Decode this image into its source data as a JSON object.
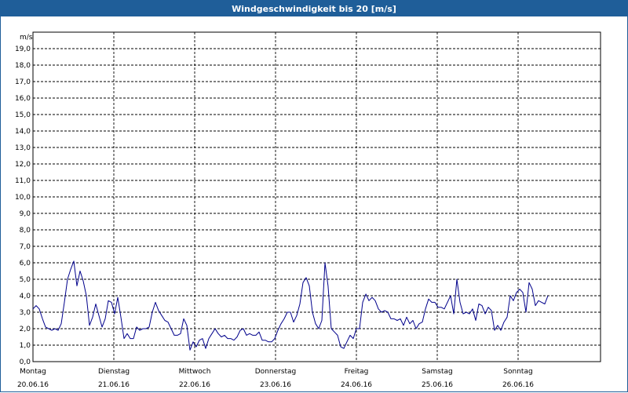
{
  "window": {
    "title": "Windgeschwindigkeit bis 20 [m/s]"
  },
  "colors": {
    "titlebar": "#1f5e99",
    "line": "#00008b"
  },
  "chart_data": {
    "type": "line",
    "title": "Windgeschwindigkeit bis 20 [m/s]",
    "ylabel": "m/s",
    "xlabel": "",
    "ylim": [
      0,
      20
    ],
    "yticks": [
      "0,0",
      "1,0",
      "2,0",
      "3,0",
      "4,0",
      "5,0",
      "6,0",
      "7,0",
      "8,0",
      "9,0",
      "10,0",
      "11,0",
      "12,0",
      "13,0",
      "14,0",
      "15,0",
      "16,0",
      "17,0",
      "18,0",
      "19,0"
    ],
    "xlim": [
      0,
      7
    ],
    "x_unit": "days from Monday 20.06.16 00:00",
    "day_labels": [
      {
        "day": "Montag",
        "date": "20.06.16"
      },
      {
        "day": "Dienstag",
        "date": "21.06.16"
      },
      {
        "day": "Mittwoch",
        "date": "22.06.16"
      },
      {
        "day": "Donnerstag",
        "date": "23.06.16"
      },
      {
        "day": "Freitag",
        "date": "24.06.16"
      },
      {
        "day": "Samstag",
        "date": "25.06.16"
      },
      {
        "day": "Sonntag",
        "date": "26.06.16"
      }
    ],
    "grid": true,
    "series": [
      {
        "color": "#00008b",
        "points": [
          [
            0.0,
            3.2
          ],
          [
            0.039,
            3.4
          ],
          [
            0.078,
            3.2
          ],
          [
            0.117,
            2.6
          ],
          [
            0.155,
            2.1
          ],
          [
            0.194,
            2.0
          ],
          [
            0.233,
            1.9
          ],
          [
            0.272,
            2.0
          ],
          [
            0.311,
            1.9
          ],
          [
            0.35,
            2.3
          ],
          [
            0.388,
            3.6
          ],
          [
            0.427,
            5.0
          ],
          [
            0.466,
            5.6
          ],
          [
            0.505,
            6.1
          ],
          [
            0.544,
            4.6
          ],
          [
            0.583,
            5.5
          ],
          [
            0.621,
            4.9
          ],
          [
            0.66,
            4.0
          ],
          [
            0.699,
            2.2
          ],
          [
            0.738,
            2.7
          ],
          [
            0.777,
            3.5
          ],
          [
            0.816,
            2.8
          ],
          [
            0.854,
            2.1
          ],
          [
            0.893,
            2.6
          ],
          [
            0.932,
            3.7
          ],
          [
            0.971,
            3.6
          ],
          [
            1.01,
            2.9
          ],
          [
            1.049,
            3.9
          ],
          [
            1.087,
            2.7
          ],
          [
            1.126,
            1.4
          ],
          [
            1.165,
            1.7
          ],
          [
            1.204,
            1.4
          ],
          [
            1.243,
            1.4
          ],
          [
            1.282,
            2.1
          ],
          [
            1.32,
            1.9
          ],
          [
            1.359,
            2.0
          ],
          [
            1.398,
            2.0
          ],
          [
            1.437,
            2.1
          ],
          [
            1.476,
            3.0
          ],
          [
            1.515,
            3.6
          ],
          [
            1.553,
            3.1
          ],
          [
            1.592,
            2.8
          ],
          [
            1.631,
            2.5
          ],
          [
            1.67,
            2.4
          ],
          [
            1.709,
            2.0
          ],
          [
            1.748,
            1.6
          ],
          [
            1.786,
            1.6
          ],
          [
            1.825,
            1.7
          ],
          [
            1.864,
            2.6
          ],
          [
            1.903,
            2.2
          ],
          [
            1.942,
            0.7
          ],
          [
            1.981,
            1.2
          ],
          [
            2.019,
            0.9
          ],
          [
            2.058,
            1.3
          ],
          [
            2.097,
            1.4
          ],
          [
            2.136,
            0.8
          ],
          [
            2.175,
            1.4
          ],
          [
            2.214,
            1.7
          ],
          [
            2.252,
            2.0
          ],
          [
            2.291,
            1.7
          ],
          [
            2.33,
            1.5
          ],
          [
            2.369,
            1.6
          ],
          [
            2.408,
            1.4
          ],
          [
            2.447,
            1.4
          ],
          [
            2.485,
            1.3
          ],
          [
            2.524,
            1.5
          ],
          [
            2.563,
            1.9
          ],
          [
            2.602,
            2.0
          ],
          [
            2.641,
            1.6
          ],
          [
            2.68,
            1.7
          ],
          [
            2.718,
            1.6
          ],
          [
            2.757,
            1.6
          ],
          [
            2.796,
            1.8
          ],
          [
            2.835,
            1.3
          ],
          [
            2.874,
            1.3
          ],
          [
            2.913,
            1.2
          ],
          [
            2.951,
            1.2
          ],
          [
            2.99,
            1.4
          ],
          [
            3.029,
            1.9
          ],
          [
            3.068,
            2.3
          ],
          [
            3.107,
            2.6
          ],
          [
            3.146,
            3.0
          ],
          [
            3.184,
            3.0
          ],
          [
            3.223,
            2.4
          ],
          [
            3.262,
            2.8
          ],
          [
            3.301,
            3.5
          ],
          [
            3.34,
            4.8
          ],
          [
            3.379,
            5.1
          ],
          [
            3.417,
            4.6
          ],
          [
            3.456,
            3.0
          ],
          [
            3.495,
            2.3
          ],
          [
            3.534,
            2.0
          ],
          [
            3.573,
            2.5
          ],
          [
            3.612,
            6.0
          ],
          [
            3.65,
            4.6
          ],
          [
            3.689,
            2.0
          ],
          [
            3.728,
            1.8
          ],
          [
            3.767,
            1.6
          ],
          [
            3.806,
            0.9
          ],
          [
            3.845,
            0.8
          ],
          [
            3.883,
            1.2
          ],
          [
            3.922,
            1.6
          ],
          [
            3.961,
            1.4
          ],
          [
            4.0,
            2.0
          ],
          [
            4.039,
            2.0
          ],
          [
            4.078,
            3.6
          ],
          [
            4.117,
            4.1
          ],
          [
            4.155,
            3.7
          ],
          [
            4.194,
            3.9
          ],
          [
            4.233,
            3.7
          ],
          [
            4.272,
            3.2
          ],
          [
            4.311,
            3.0
          ],
          [
            4.35,
            3.1
          ],
          [
            4.388,
            3.0
          ],
          [
            4.427,
            2.6
          ],
          [
            4.466,
            2.6
          ],
          [
            4.505,
            2.5
          ],
          [
            4.544,
            2.6
          ],
          [
            4.583,
            2.2
          ],
          [
            4.621,
            2.7
          ],
          [
            4.66,
            2.3
          ],
          [
            4.699,
            2.5
          ],
          [
            4.738,
            2.0
          ],
          [
            4.777,
            2.3
          ],
          [
            4.816,
            2.4
          ],
          [
            4.854,
            3.2
          ],
          [
            4.893,
            3.8
          ],
          [
            4.932,
            3.6
          ],
          [
            4.971,
            3.6
          ],
          [
            5.01,
            3.3
          ],
          [
            5.049,
            3.3
          ],
          [
            5.087,
            3.2
          ],
          [
            5.126,
            3.6
          ],
          [
            5.165,
            4.0
          ],
          [
            5.204,
            2.9
          ],
          [
            5.243,
            5.0
          ],
          [
            5.282,
            3.6
          ],
          [
            5.32,
            2.9
          ],
          [
            5.359,
            3.0
          ],
          [
            5.398,
            2.9
          ],
          [
            5.437,
            3.2
          ],
          [
            5.476,
            2.5
          ],
          [
            5.515,
            3.5
          ],
          [
            5.553,
            3.4
          ],
          [
            5.592,
            2.9
          ],
          [
            5.631,
            3.3
          ],
          [
            5.67,
            3.1
          ],
          [
            5.709,
            1.9
          ],
          [
            5.748,
            2.2
          ],
          [
            5.786,
            1.9
          ],
          [
            5.825,
            2.4
          ],
          [
            5.864,
            2.7
          ],
          [
            5.903,
            4.0
          ],
          [
            5.942,
            3.7
          ],
          [
            5.981,
            4.2
          ],
          [
            6.019,
            4.4
          ],
          [
            6.058,
            4.2
          ],
          [
            6.097,
            3.0
          ],
          [
            6.136,
            4.8
          ],
          [
            6.175,
            4.4
          ],
          [
            6.214,
            3.4
          ],
          [
            6.252,
            3.7
          ],
          [
            6.291,
            3.6
          ],
          [
            6.33,
            3.5
          ],
          [
            6.369,
            4.0
          ]
        ]
      }
    ]
  }
}
